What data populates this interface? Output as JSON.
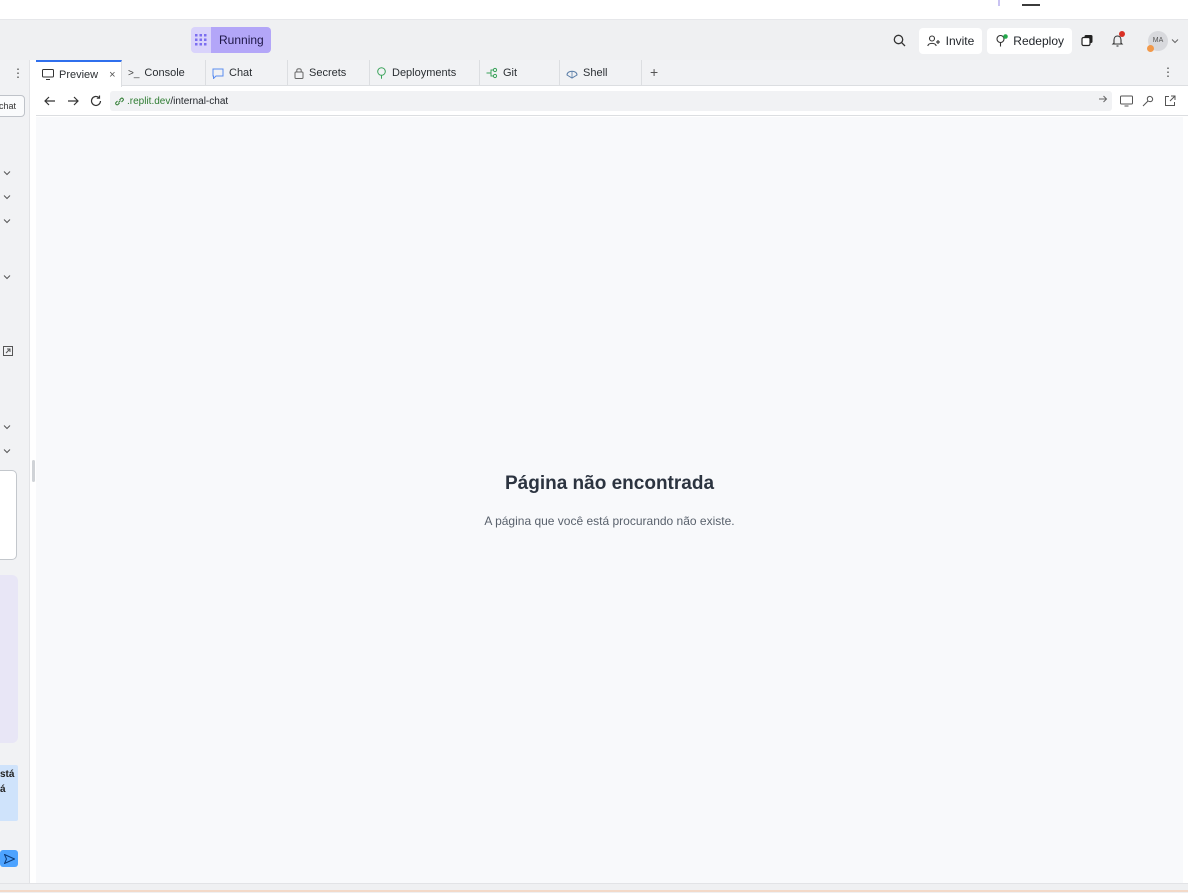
{
  "header": {
    "run_label": "Running",
    "invite_label": "Invite",
    "redeploy_label": "Redeploy",
    "avatar_initials": "MA"
  },
  "left_panel": {
    "chat_button_label": "chat",
    "note_text": "stá á"
  },
  "tabs": [
    {
      "label": "Preview",
      "icon": "monitor-icon",
      "active": true
    },
    {
      "label": "Console",
      "icon": "terminal-icon"
    },
    {
      "label": "Chat",
      "icon": "chat-bubble-icon"
    },
    {
      "label": "Secrets",
      "icon": "lock-icon"
    },
    {
      "label": "Deployments",
      "icon": "deploy-icon"
    },
    {
      "label": "Git",
      "icon": "git-icon"
    },
    {
      "label": "Shell",
      "icon": "shell-icon"
    }
  ],
  "url": {
    "host": ".replit.dev",
    "path": "/internal-chat"
  },
  "page": {
    "title": "Página não encontrada",
    "subtitle": "A página que você está procurando não existe."
  },
  "colors": {
    "accent": "#2f6fed",
    "run_button": "#b3a6f8",
    "url_host": "#2f7d32"
  }
}
